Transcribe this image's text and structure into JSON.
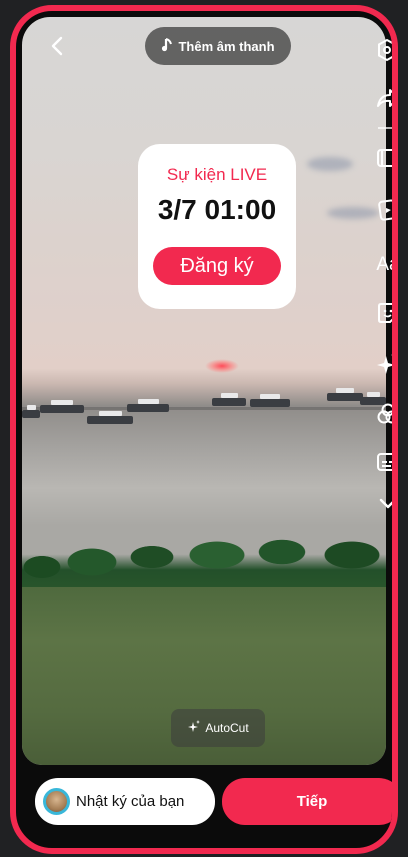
{
  "top_bar": {
    "add_sound_label": "Thêm âm thanh",
    "back_icon": "back-icon",
    "settings_icon": "settings-icon"
  },
  "right_tools": {
    "icons": [
      "share-icon",
      "film-strip-icon",
      "sticker-card-icon",
      "text-icon",
      "sticker-icon",
      "sparkle-effects-icon",
      "filter-circles-icon",
      "caption-icon",
      "chevron-down-icon"
    ],
    "text_tool_label": "Aa"
  },
  "event_card": {
    "label": "Sự kiện LIVE",
    "datetime": "3/7 01:00",
    "register_label": "Đăng ký"
  },
  "autocut": {
    "label": "AutoCut"
  },
  "bottom_bar": {
    "diary_label": "Nhật ký của bạn",
    "next_label": "Tiếp"
  },
  "colors": {
    "accent": "#f2294f",
    "frame": "#f2294f",
    "background": "#202123"
  }
}
